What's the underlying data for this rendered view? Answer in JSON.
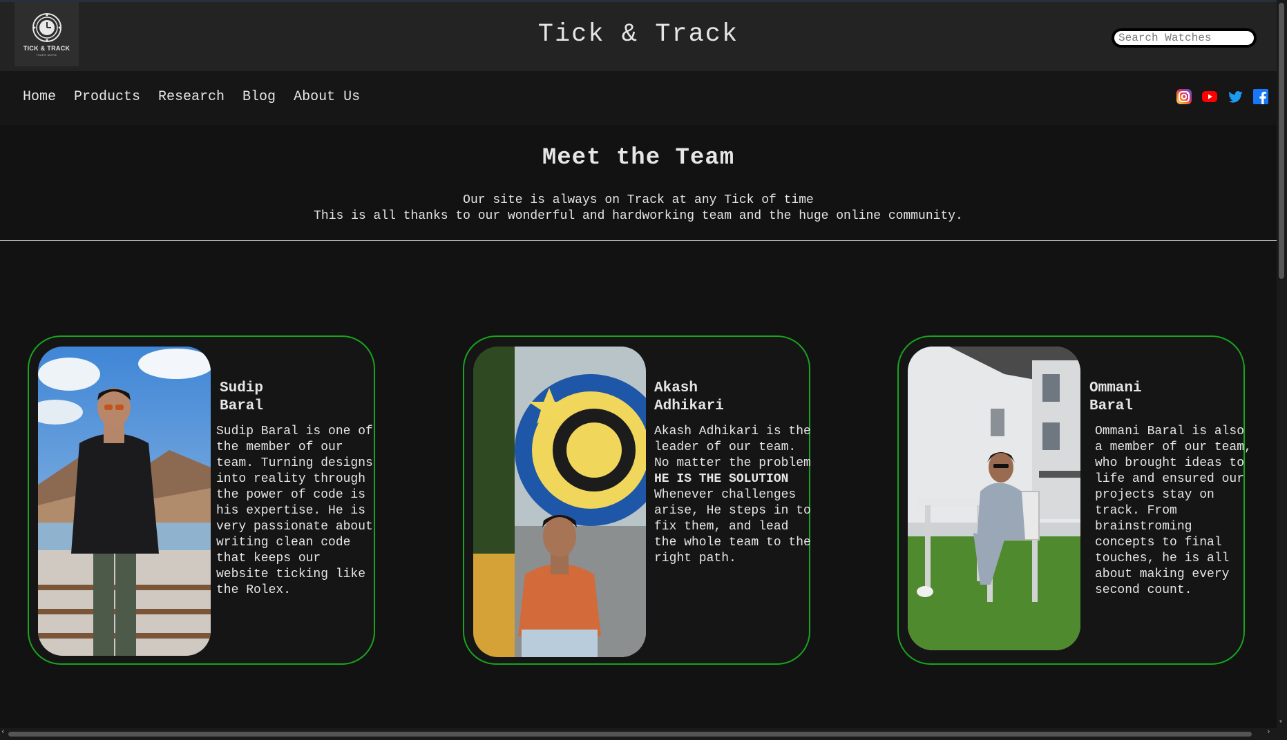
{
  "header": {
    "logo_text": "TICK & TRACK",
    "logo_tagline": "TIMES MORE",
    "site_title": "Tick & Track",
    "search_placeholder": "Search Watches"
  },
  "nav": {
    "links": [
      "Home",
      "Products",
      "Research",
      "Blog",
      "About Us"
    ],
    "socials": [
      "instagram-icon",
      "youtube-icon",
      "twitter-icon",
      "facebook-icon"
    ]
  },
  "intro": {
    "title": "Meet the Team",
    "line1": "Our site is always on Track at any Tick of time",
    "line2": "This is all thanks to our wonderful and hardworking team and the huge online community."
  },
  "team": [
    {
      "first": "Sudip",
      "last": "Baral",
      "bio": "Sudip Baral is one of the member of our team. Turning designs into reality through the power of code is his expertise. He is very passionate about writing clean code that keeps our website ticking like the Rolex."
    },
    {
      "first": "Akash",
      "last": "Adhikari",
      "bio_before": "Akash Adhikari is the leader of our team. No matter the problem ",
      "bio_bold": "HE IS THE SOLUTION",
      "bio_after": " Whenever challenges arise, He steps in to fix them, and lead the whole team to the right path."
    },
    {
      "first": "Ommani",
      "last": "Baral",
      "bio": "Ommani Baral is also a member of our team, who brought ideas to life and ensured our projects stay on track. From brainstroming concepts to final touches, he is all about making every second count."
    }
  ],
  "colors": {
    "card_border": "#17a51d",
    "page_bg": "#121212",
    "header_bg": "#232323"
  }
}
